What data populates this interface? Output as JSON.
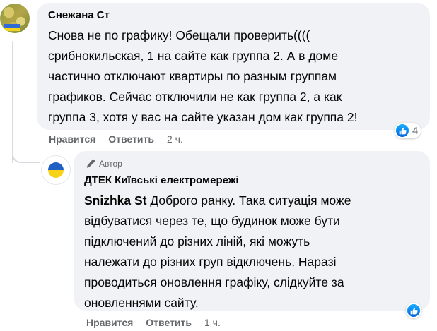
{
  "comment": {
    "author": "Снежана Ст",
    "lines": [
      "Снова не по графику! Обещали проверить((((",
      "срибнокильская, 1 на сайте как группа 2. А в доме",
      "частично отключают квартиры по разным группам",
      "графиков. Сейчас отключили не как группа 2, а как",
      "группа 3, хотя у вас на сайте указан дом как группа 2!"
    ],
    "like_label": "Нравится",
    "reply_label": "Ответить",
    "time": "2 ч.",
    "reaction_count": "4",
    "reaction_icon": "like-icon"
  },
  "reply": {
    "badge_label": "Автор",
    "badge_icon": "pen-icon",
    "author": "ДТЕК Київські електромережі",
    "mention": "Snizhka St",
    "lines": [
      "Доброго ранку. Така ситуація може",
      "відбуватися через те, що будинок може бути",
      "підключений до різних ліній, які можуть",
      "належати до різних груп відключень. Наразі",
      "проводиться оновлення графіку, слідкуйте за",
      "оновленнями сайту."
    ],
    "like_label": "Нравится",
    "reply_label": "Ответить",
    "time": "1 ч.",
    "reaction_icon": "like-icon"
  },
  "colors": {
    "bubble": "#f0f2f5",
    "secondary_text": "#65676b",
    "like_blue": "#0866ff",
    "flag_blue": "#1f5fc4",
    "flag_yellow": "#f7d218"
  }
}
